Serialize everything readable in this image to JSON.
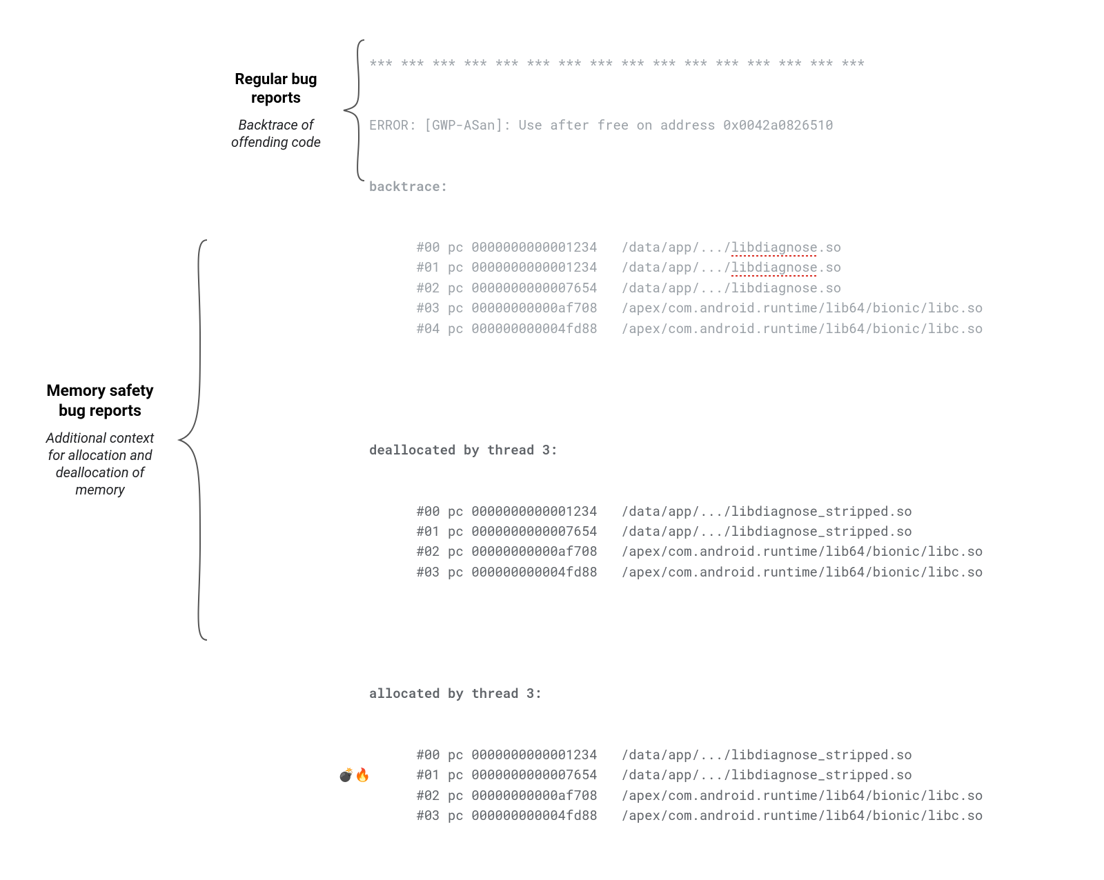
{
  "outer": {
    "title_l1": "Memory safety",
    "title_l2": "bug reports",
    "sub_l1": "Additional context",
    "sub_l2": "for allocation and",
    "sub_l3": "deallocation of",
    "sub_l4": "memory"
  },
  "inner": {
    "title_l1": "Regular bug",
    "title_l2": "reports",
    "sub_l1": "Backtrace of",
    "sub_l2": "offending code"
  },
  "stars": "*** *** *** *** *** *** *** *** *** *** *** *** *** *** *** ***",
  "error": "ERROR: [GWP-ASan]: Use after free on address 0x0042a0826510",
  "bt_hdr": "backtrace:",
  "bt": [
    {
      "frame": "#00",
      "pc": "0000000000001234",
      "pathPrefix": "/data/app/.../",
      "lib": "libdiagnose",
      "libSuffix": ".so",
      "underline": true
    },
    {
      "frame": "#01",
      "pc": "0000000000001234",
      "pathPrefix": "/data/app/.../",
      "lib": "libdiagnose",
      "libSuffix": ".so",
      "underline": true
    },
    {
      "frame": "#02",
      "pc": "0000000000007654",
      "pathPrefix": "/data/app/.../",
      "lib": "libdiagnose.so",
      "libSuffix": "",
      "underline": false
    },
    {
      "frame": "#03",
      "pc": "00000000000af708",
      "pathPrefix": "/apex/com.android.runtime/lib64/bionic/libc.so",
      "lib": "",
      "libSuffix": "",
      "underline": false
    },
    {
      "frame": "#04",
      "pc": "000000000004fd88",
      "pathPrefix": "/apex/com.android.runtime/lib64/bionic/libc.so",
      "lib": "",
      "libSuffix": "",
      "underline": false
    }
  ],
  "dealloc_hdr": "deallocated by thread 3:",
  "dealloc": [
    {
      "frame": "#00",
      "pc": "0000000000001234",
      "path": "/data/app/.../libdiagnose_stripped.so"
    },
    {
      "frame": "#01",
      "pc": "0000000000007654",
      "path": "/data/app/.../libdiagnose_stripped.so"
    },
    {
      "frame": "#02",
      "pc": "00000000000af708",
      "path": "/apex/com.android.runtime/lib64/bionic/libc.so"
    },
    {
      "frame": "#03",
      "pc": "000000000004fd88",
      "path": "/apex/com.android.runtime/lib64/bionic/libc.so"
    }
  ],
  "alloc_hdr": "allocated by thread 3:",
  "alloc": [
    {
      "frame": "#00",
      "pc": "0000000000001234",
      "path": "/data/app/.../libdiagnose_stripped.so",
      "emoji": ""
    },
    {
      "frame": "#01",
      "pc": "0000000000007654",
      "path": "/data/app/.../libdiagnose_stripped.so",
      "emoji": "💣🔥"
    },
    {
      "frame": "#02",
      "pc": "00000000000af708",
      "path": "/apex/com.android.runtime/lib64/bionic/libc.so",
      "emoji": ""
    },
    {
      "frame": "#03",
      "pc": "000000000004fd88",
      "path": "/apex/com.android.runtime/lib64/bionic/libc.so",
      "emoji": ""
    }
  ]
}
